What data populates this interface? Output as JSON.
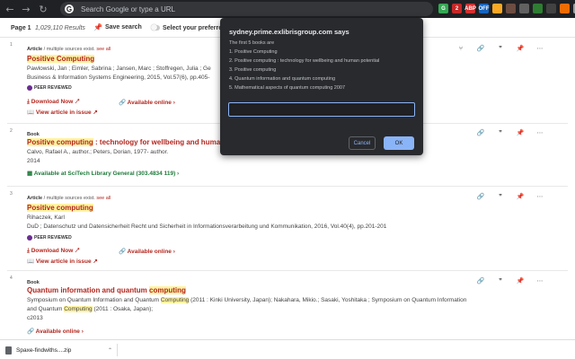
{
  "browser": {
    "omnibox_placeholder": "Search Google or type a URL",
    "extensions": [
      {
        "label": "G",
        "color": "#34a853"
      },
      {
        "label": "2",
        "color": "#c62828"
      },
      {
        "label": "ABP",
        "color": "#d32f2f"
      },
      {
        "label": "OFF",
        "color": "#1565c0"
      },
      {
        "label": "",
        "color": "#f9a825"
      },
      {
        "label": "",
        "color": "#6d4c41"
      },
      {
        "label": "",
        "color": "#616161"
      },
      {
        "label": "",
        "color": "#2e7d32"
      },
      {
        "label": "",
        "color": "#424242"
      },
      {
        "label": "",
        "color": "#ef6c00"
      },
      {
        "label": "",
        "color": "#9e9e9e"
      },
      {
        "label": "",
        "color": "#e53935"
      }
    ]
  },
  "header": {
    "page_label": "Page 1",
    "result_count": "1,029,110 Results",
    "save_search": "Save search",
    "select_preferred": "Select your preferred"
  },
  "results": [
    {
      "rank": "1",
      "type": "Article",
      "type_extra": " / multiple sources exist.",
      "see_all": "see all",
      "title": "Positive Computing",
      "line1": "Pawlowski, Jan ; Eimler, Sabrina ; Jansen, Marc ; Stoffregen, Julia ; Ge",
      "line2": "Business & Information Systems Engineering, 2015, Vol.57(6), pp.405-",
      "peer": "PEER REVIEWED",
      "download": "Download Now",
      "available": "Available online",
      "view_issue": "View article in issue"
    },
    {
      "rank": "2",
      "type": "Book",
      "title_a": "Positive computing",
      "title_b": " : technology for wellbeing and human",
      "line1": "Calvo, Rafael A., author.; Peters, Dorian, 1977- author.",
      "line2": "2014",
      "available_at": "Available at SciTech Library  General (303.4834 119)"
    },
    {
      "rank": "3",
      "type": "Article",
      "type_extra": " / multiple sources exist.",
      "see_all": "see all",
      "title": "Positive computing",
      "line1": "Rihaczek, Karl",
      "line2": "DuD ; Datenschutz und Datensicherheit Recht und Sicherheit in Informationsverarbeitung und Kommunikation, 2016, Vol.40(4), pp.201-201",
      "peer": "PEER REVIEWED",
      "download": "Download Now",
      "available": "Available online",
      "view_issue": "View article in issue"
    },
    {
      "rank": "4",
      "type": "Book",
      "title_a": "Quantum information and quantum ",
      "title_b": "computing",
      "line1a": "Symposium on Quantum Information and Quantum ",
      "line1b": "Computing",
      "line1c": " (2011 : Kinki University, Japan); Nakahara, Mikio.; Sasaki, Yoshitaka ; Symposium on Quantum Information",
      "line2a": "and Quantum ",
      "line2b": "Computing",
      "line2c": " (2011 : Osaka, Japan);",
      "line3": "c2013",
      "available": "Available online"
    }
  ],
  "dialog": {
    "title": "sydney.prime.exlibrisgroup.com says",
    "lines": [
      "The first 5 books are",
      "1. Positive Computing",
      "2. Positive computing : technology for wellbeing and human potential",
      "3. Positive computing",
      "4. Quantum information and quantum computing",
      "5. Mathematical aspects of quantum computing 2007"
    ],
    "input_value": "",
    "cancel": "Cancel",
    "ok": "OK"
  },
  "download_bar": {
    "filename": "Spaxe-findwiths....zip"
  }
}
